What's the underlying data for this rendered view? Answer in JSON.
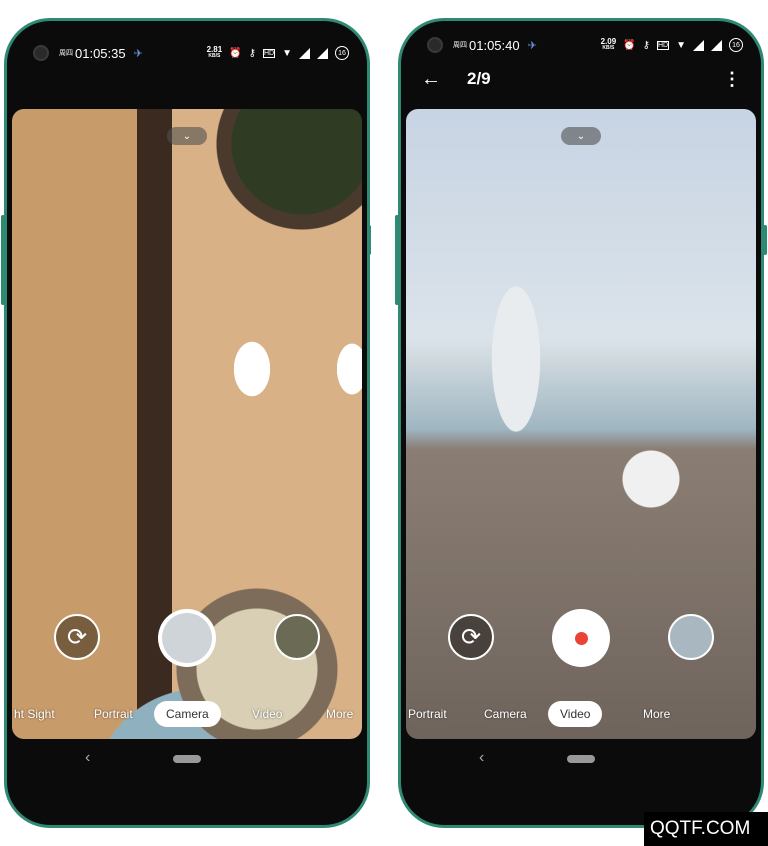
{
  "left_phone": {
    "status": {
      "weekday": "周四",
      "time": "01:05:35",
      "speed": "2.81",
      "speed_unit": "KB/S",
      "battery": "16"
    },
    "modes": [
      {
        "label": "ht Sight"
      },
      {
        "label": "Portrait"
      },
      {
        "label": "Camera",
        "selected": true
      },
      {
        "label": "Video"
      },
      {
        "label": "More"
      }
    ]
  },
  "right_phone": {
    "status": {
      "weekday": "周四",
      "time": "01:05:40",
      "speed": "2.09",
      "speed_unit": "KB/S",
      "battery": "16"
    },
    "counter": "2/9",
    "modes": [
      {
        "label": "Portrait"
      },
      {
        "label": "Camera"
      },
      {
        "label": "Video",
        "selected": true
      },
      {
        "label": "More"
      }
    ]
  },
  "icons": {
    "back": "arrow-left-icon",
    "menu": "more-vert-icon",
    "flip": "flip-camera-icon",
    "expand": "chevron-down-icon"
  },
  "colors": {
    "frame": "#2f8a73",
    "record": "#ea4335"
  },
  "watermark": "QQTF.COM"
}
